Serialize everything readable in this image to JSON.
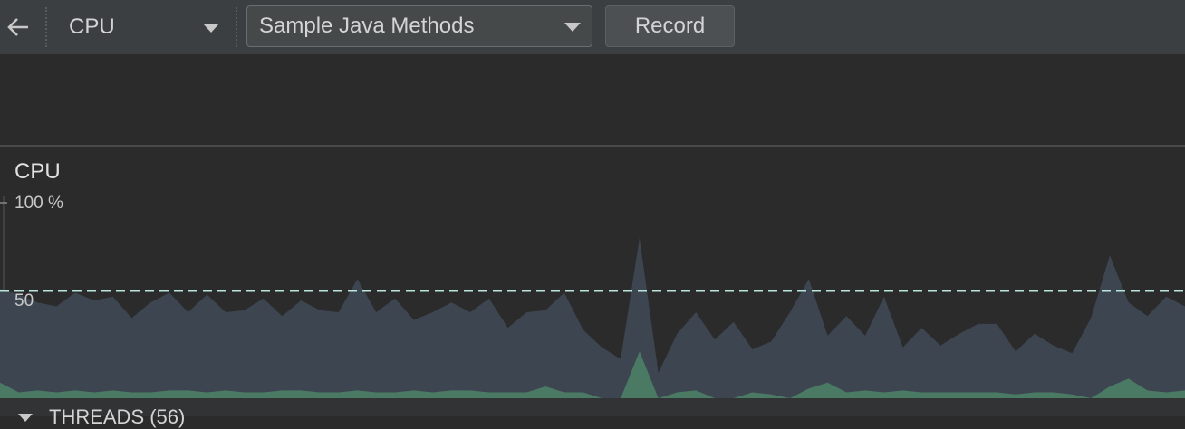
{
  "toolbar": {
    "monitor_select": "CPU",
    "config_select": "Sample Java Methods",
    "record_label": "Record",
    "icons": {
      "back": "back-arrow-icon",
      "dropdown": "chevron-down-icon"
    }
  },
  "cpu_panel": {
    "title": "CPU",
    "y_max_label": "100 %",
    "y_mid_label": "50"
  },
  "threads_header": {
    "label": "THREADS (56)"
  },
  "chart_data": {
    "type": "area",
    "ylim": [
      0,
      100
    ],
    "threshold": 55,
    "series": [
      {
        "color": "#3d4550",
        "values": [
          56,
          53,
          49,
          47,
          54,
          50,
          52,
          41,
          49,
          54,
          44,
          53,
          44,
          45,
          51,
          42,
          50,
          45,
          44,
          61,
          44,
          51,
          40,
          44,
          49,
          44,
          51,
          36,
          44,
          45,
          54,
          35,
          26,
          20,
          82,
          13,
          33,
          44,
          30,
          39,
          25,
          29,
          44,
          61,
          32,
          42,
          32,
          52,
          26,
          36,
          27,
          33,
          38,
          38,
          24,
          33,
          27,
          23,
          41,
          73,
          49,
          42,
          52,
          47
        ]
      },
      {
        "color": "#4a7a63",
        "values": [
          8,
          3,
          4,
          3,
          4,
          3,
          4,
          3,
          3,
          4,
          4,
          3,
          4,
          3,
          3,
          4,
          4,
          3,
          3,
          4,
          3,
          3,
          4,
          3,
          4,
          4,
          3,
          3,
          3,
          6,
          3,
          3,
          0,
          0,
          24,
          0,
          3,
          4,
          0,
          0,
          3,
          2,
          0,
          5,
          8,
          3,
          4,
          3,
          4,
          3,
          3,
          3,
          3,
          3,
          2,
          3,
          3,
          2,
          0,
          6,
          10,
          4,
          3,
          4
        ]
      }
    ]
  }
}
